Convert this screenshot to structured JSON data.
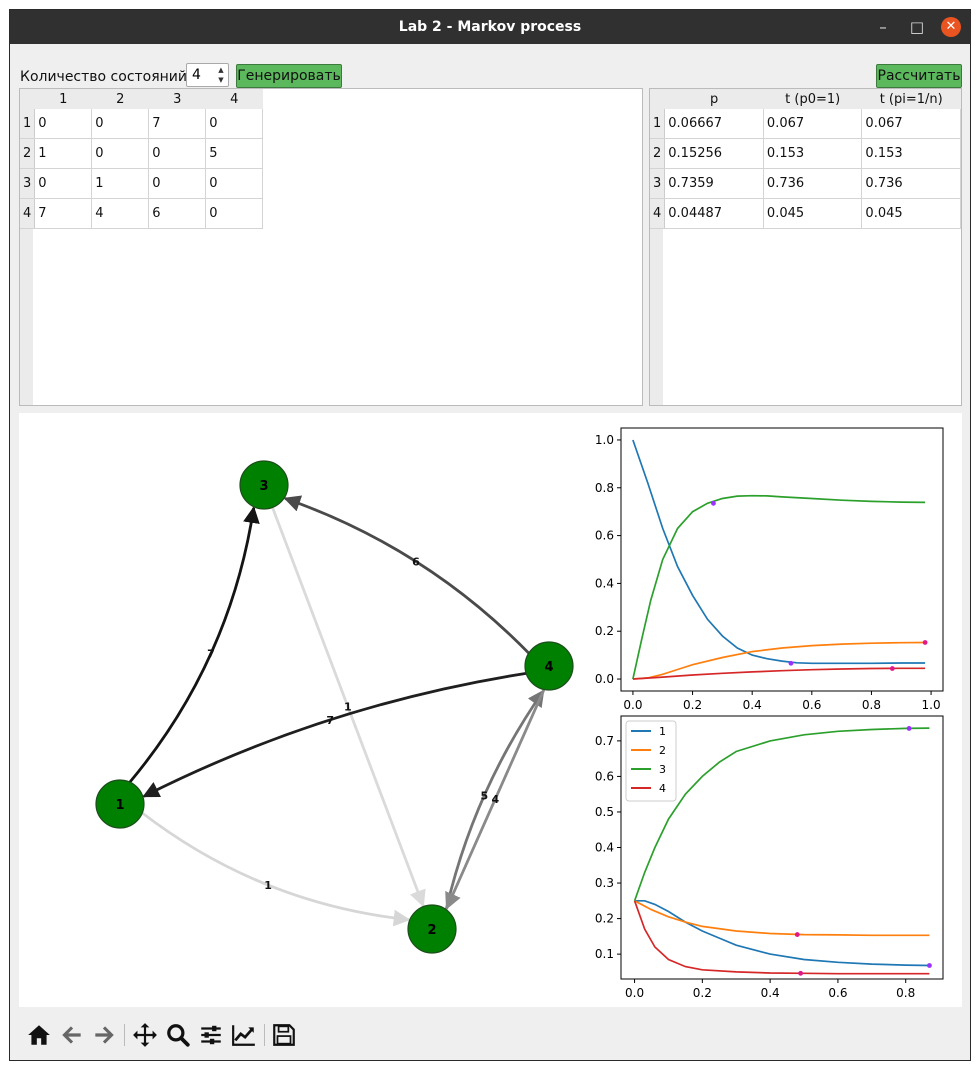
{
  "window": {
    "title": "Lab 2 - Markov process",
    "controls": {
      "minimize": "–",
      "maximize": "□",
      "close": "✕"
    }
  },
  "top": {
    "count_label": "Количество состояний",
    "count_value": "4",
    "generate_label": "Генерировать",
    "calculate_label": "Рассчитать"
  },
  "matrix": {
    "columns": [
      "1",
      "2",
      "3",
      "4"
    ],
    "rows": [
      {
        "label": "1",
        "cells": [
          "0",
          "0",
          "7",
          "0"
        ]
      },
      {
        "label": "2",
        "cells": [
          "1",
          "0",
          "0",
          "5"
        ]
      },
      {
        "label": "3",
        "cells": [
          "0",
          "1",
          "0",
          "0"
        ]
      },
      {
        "label": "4",
        "cells": [
          "7",
          "4",
          "6",
          "0"
        ]
      }
    ]
  },
  "results": {
    "columns": [
      "p",
      "t (p0=1)",
      "t (pi=1/n)"
    ],
    "rows": [
      {
        "label": "1",
        "cells": [
          "0.06667",
          "0.067",
          "0.067"
        ]
      },
      {
        "label": "2",
        "cells": [
          "0.15256",
          "0.153",
          "0.153"
        ]
      },
      {
        "label": "3",
        "cells": [
          "0.7359",
          "0.736",
          "0.736"
        ]
      },
      {
        "label": "4",
        "cells": [
          "0.04487",
          "0.045",
          "0.045"
        ]
      }
    ]
  },
  "graph": {
    "node_color": "#008000",
    "nodes": [
      "1",
      "2",
      "3",
      "4"
    ],
    "edges": [
      {
        "from": "1",
        "to": "3",
        "label": "7",
        "shade": 0
      },
      {
        "from": "1",
        "to": "2",
        "label": "1",
        "shade": 0.9
      },
      {
        "from": "2",
        "to": "4",
        "label": "5",
        "shade": 0.45
      },
      {
        "from": "3",
        "to": "2",
        "label": "1",
        "shade": 0.92
      },
      {
        "from": "4",
        "to": "1",
        "label": "7",
        "shade": 0.05
      },
      {
        "from": "4",
        "to": "2",
        "label": "4",
        "shade": 0.55
      },
      {
        "from": "4",
        "to": "3",
        "label": "6",
        "shade": 0.25
      }
    ]
  },
  "chart_data": [
    {
      "type": "line",
      "title": "",
      "xlim": [
        -0.04,
        1.04
      ],
      "ylim": [
        -0.05,
        1.05
      ],
      "xticks": [
        "0.0",
        "0.2",
        "0.4",
        "0.6",
        "0.8",
        "1.0"
      ],
      "yticks": [
        "0.0",
        "0.2",
        "0.4",
        "0.6",
        "0.8",
        "1.0"
      ],
      "series": [
        {
          "color": "#1f77b4",
          "x": [
            0,
            0.05,
            0.1,
            0.15,
            0.2,
            0.25,
            0.3,
            0.35,
            0.4,
            0.45,
            0.5,
            0.55,
            0.6,
            0.7,
            0.8,
            0.9,
            0.98
          ],
          "y": [
            1.0,
            0.82,
            0.63,
            0.47,
            0.35,
            0.25,
            0.18,
            0.13,
            0.1,
            0.085,
            0.075,
            0.068,
            0.066,
            0.066,
            0.066,
            0.067,
            0.067
          ]
        },
        {
          "color": "#ff7f0e",
          "x": [
            0,
            0.05,
            0.1,
            0.15,
            0.2,
            0.3,
            0.4,
            0.5,
            0.6,
            0.7,
            0.8,
            0.9,
            0.98
          ],
          "y": [
            0.0,
            0.005,
            0.02,
            0.04,
            0.06,
            0.09,
            0.115,
            0.13,
            0.14,
            0.146,
            0.15,
            0.152,
            0.153
          ]
        },
        {
          "color": "#2ca02c",
          "x": [
            0,
            0.03,
            0.06,
            0.1,
            0.15,
            0.2,
            0.25,
            0.3,
            0.35,
            0.4,
            0.45,
            0.5,
            0.6,
            0.7,
            0.8,
            0.9,
            0.98
          ],
          "y": [
            0.0,
            0.17,
            0.33,
            0.5,
            0.63,
            0.7,
            0.735,
            0.755,
            0.765,
            0.767,
            0.766,
            0.762,
            0.755,
            0.748,
            0.743,
            0.74,
            0.739
          ]
        },
        {
          "color": "#d62728",
          "x": [
            0,
            0.1,
            0.2,
            0.3,
            0.4,
            0.5,
            0.6,
            0.7,
            0.8,
            0.9,
            0.98
          ],
          "y": [
            0.0,
            0.008,
            0.017,
            0.024,
            0.03,
            0.035,
            0.039,
            0.042,
            0.044,
            0.045,
            0.045
          ]
        }
      ],
      "markers": [
        {
          "x": 0.27,
          "y": 0.735,
          "color": "#9b30ff"
        },
        {
          "x": 0.53,
          "y": 0.066,
          "color": "#9b30ff"
        },
        {
          "x": 0.98,
          "y": 0.153,
          "color": "#e0198a"
        },
        {
          "x": 0.87,
          "y": 0.044,
          "color": "#e0198a"
        }
      ]
    },
    {
      "type": "line",
      "title": "",
      "xlim": [
        -0.04,
        0.91
      ],
      "ylim": [
        0.03,
        0.77
      ],
      "xticks": [
        "0.0",
        "0.2",
        "0.4",
        "0.6",
        "0.8"
      ],
      "yticks": [
        "0.1",
        "0.2",
        "0.3",
        "0.4",
        "0.5",
        "0.6",
        "0.7"
      ],
      "legend": {
        "position": "upper-left",
        "entries": [
          "1",
          "2",
          "3",
          "4"
        ]
      },
      "series": [
        {
          "name": "1",
          "color": "#1f77b4",
          "x": [
            0,
            0.03,
            0.06,
            0.1,
            0.15,
            0.2,
            0.25,
            0.3,
            0.4,
            0.5,
            0.6,
            0.7,
            0.8,
            0.87
          ],
          "y": [
            0.25,
            0.25,
            0.24,
            0.22,
            0.19,
            0.165,
            0.145,
            0.125,
            0.1,
            0.085,
            0.077,
            0.072,
            0.069,
            0.068
          ]
        },
        {
          "name": "2",
          "color": "#ff7f0e",
          "x": [
            0,
            0.05,
            0.1,
            0.15,
            0.2,
            0.3,
            0.4,
            0.5,
            0.6,
            0.7,
            0.8,
            0.87
          ],
          "y": [
            0.25,
            0.225,
            0.205,
            0.19,
            0.178,
            0.165,
            0.158,
            0.155,
            0.154,
            0.153,
            0.153,
            0.153
          ]
        },
        {
          "name": "3",
          "color": "#2ca02c",
          "x": [
            0,
            0.03,
            0.06,
            0.1,
            0.15,
            0.2,
            0.25,
            0.3,
            0.4,
            0.5,
            0.6,
            0.7,
            0.8,
            0.87
          ],
          "y": [
            0.25,
            0.33,
            0.4,
            0.48,
            0.55,
            0.6,
            0.64,
            0.67,
            0.7,
            0.717,
            0.727,
            0.732,
            0.735,
            0.736
          ]
        },
        {
          "name": "4",
          "color": "#d62728",
          "x": [
            0,
            0.03,
            0.06,
            0.1,
            0.15,
            0.2,
            0.3,
            0.4,
            0.5,
            0.6,
            0.7,
            0.8,
            0.87
          ],
          "y": [
            0.25,
            0.17,
            0.12,
            0.085,
            0.065,
            0.056,
            0.05,
            0.047,
            0.046,
            0.045,
            0.045,
            0.045,
            0.045
          ]
        }
      ],
      "markers": [
        {
          "x": 0.81,
          "y": 0.735,
          "color": "#9b30ff"
        },
        {
          "x": 0.48,
          "y": 0.155,
          "color": "#e0198a"
        },
        {
          "x": 0.87,
          "y": 0.068,
          "color": "#9b30ff"
        },
        {
          "x": 0.49,
          "y": 0.046,
          "color": "#e0198a"
        }
      ]
    }
  ],
  "toolbar": {
    "icons": [
      "home-icon",
      "back-arrow-icon",
      "forward-arrow-icon",
      "pan-icon",
      "zoom-icon",
      "subplots-config-icon",
      "edit-curves-icon",
      "save-icon"
    ]
  }
}
